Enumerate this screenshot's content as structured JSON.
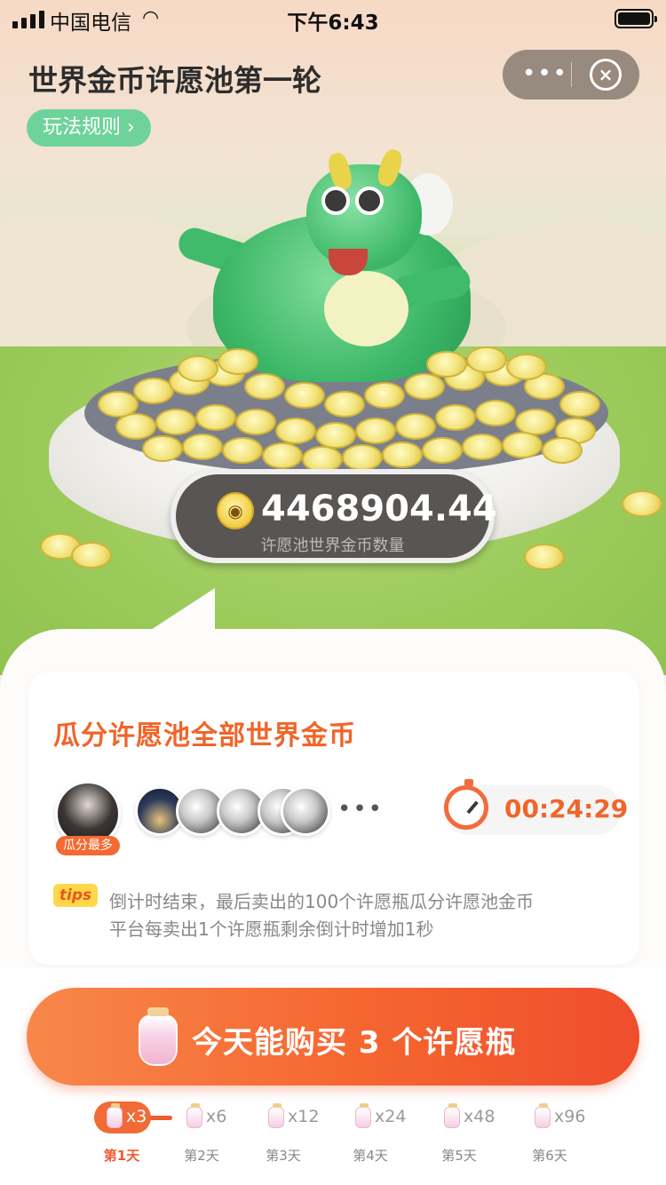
{
  "status_bar": {
    "carrier": "中国电信",
    "time": "下午6:43"
  },
  "header": {
    "title": "世界金币许愿池第一轮",
    "more_label": "•••",
    "close_label": "×",
    "rules_label": "玩法规则 ›"
  },
  "pool": {
    "coin_count": "4468904.44",
    "coin_label": "许愿池世界金币数量",
    "coin_icon": "piggy-coin-icon"
  },
  "card": {
    "title": "瓜分许愿池全部世界金币",
    "top_badge": "瓜分最多",
    "more_dots": "•••",
    "countdown": "00:24:29",
    "tips_tag": "tips",
    "tips": [
      "倒计时结束，最后卖出的100个许愿瓶瓜分许愿池金币",
      "平台每卖出1个许愿瓶剩余倒计时增加1秒"
    ]
  },
  "buy": {
    "label": "今天能购买 3 个许愿瓶"
  },
  "days": [
    {
      "mult": "x3",
      "label": "第1天",
      "active": true
    },
    {
      "mult": "x6",
      "label": "第2天",
      "active": false
    },
    {
      "mult": "x12",
      "label": "第3天",
      "active": false
    },
    {
      "mult": "x24",
      "label": "第4天",
      "active": false
    },
    {
      "mult": "x48",
      "label": "第5天",
      "active": false
    },
    {
      "mult": "x96",
      "label": "第6天",
      "active": false
    }
  ],
  "colors": {
    "accent": "#f0652a",
    "rules_bg": "#6ed39a",
    "counter_bg": "#585552"
  }
}
